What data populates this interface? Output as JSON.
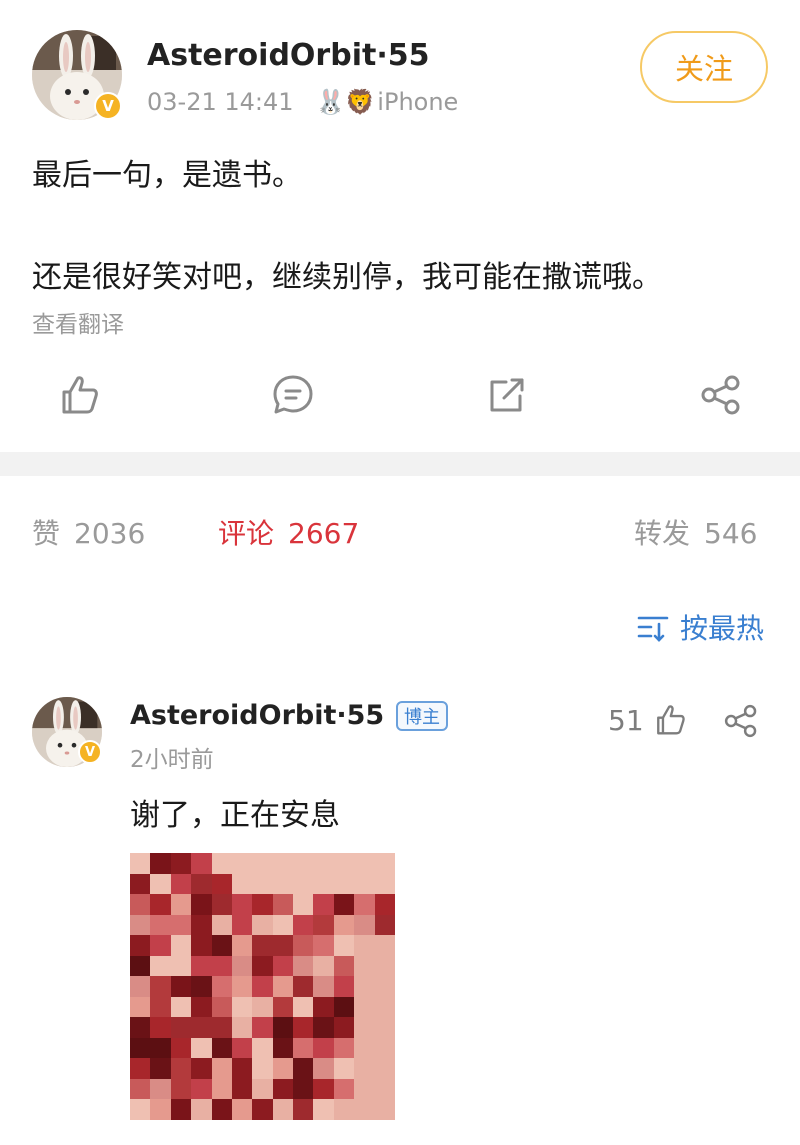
{
  "post": {
    "author": {
      "name": "AsteroidOrbit·55",
      "verified_mark": "V"
    },
    "timestamp": "03-21 14:41",
    "device_emojis": "🐰🦁",
    "device": "iPhone",
    "follow_label": "关注",
    "text_lines": [
      "最后一句，是遗书。",
      "还是很好笑对吧，继续别停，我可能在撒谎哦。"
    ],
    "translate_label": "查看翻译",
    "actions": [
      "thumbs-up-icon",
      "comment-icon",
      "repost-icon",
      "share-icon"
    ]
  },
  "stats": {
    "like_label": "赞",
    "like_count": "2036",
    "comment_label": "评论",
    "comment_count": "2667",
    "repost_label": "转发",
    "repost_count": "546",
    "active_tab": "comment",
    "active_color": "#d9343b"
  },
  "sort": {
    "label": "按最热"
  },
  "comment": {
    "author": "AsteroidOrbit·55",
    "verified_mark": "V",
    "author_badge": "博主",
    "time": "2小时前",
    "text": "谢了，正在安息",
    "like_count": "51",
    "has_image": true
  },
  "colors": {
    "accent_orange": "#f09b1a",
    "verify_gold": "#f5b323",
    "link_blue": "#3a7fd0",
    "comment_red": "#d9343b"
  }
}
